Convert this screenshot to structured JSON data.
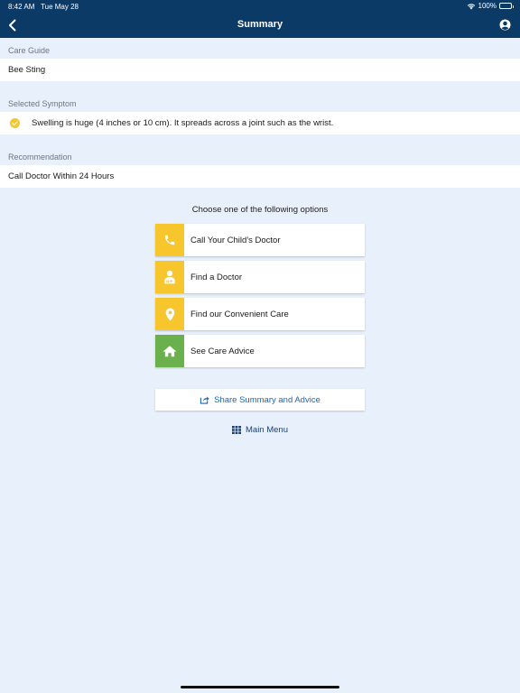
{
  "status": {
    "time": "8:42 AM",
    "date": "Tue May 28",
    "battery": "100%",
    "battery_level": 1.0
  },
  "header": {
    "title": "Summary",
    "back_icon": "chevron-left-icon",
    "account_icon": "user-circle-icon"
  },
  "care_guide": {
    "label": "Care Guide",
    "value": "Bee Sting"
  },
  "selected_symptom": {
    "label": "Selected Symptom",
    "value": "Swelling is huge (4 inches or 10 cm). It spreads across a joint such as the wrist.",
    "icon": "check-circle-icon"
  },
  "recommendation": {
    "label": "Recommendation",
    "value": "Call Doctor Within 24 Hours"
  },
  "options": {
    "title": "Choose one of the following options",
    "items": [
      {
        "label": "Call Your Child's Doctor",
        "icon": "phone-icon",
        "color": "#f7c52c"
      },
      {
        "label": "Find a Doctor",
        "icon": "doctor-icon",
        "color": "#f7c52c"
      },
      {
        "label": "Find our Convenient Care",
        "icon": "map-pin-icon",
        "color": "#f7c52c"
      },
      {
        "label": "See Care Advice",
        "icon": "home-icon",
        "color": "#6ab04c"
      }
    ]
  },
  "share": {
    "label": "Share Summary and Advice",
    "icon": "share-icon",
    "color": "#1d64b8"
  },
  "main_menu": {
    "label": "Main Menu",
    "icon": "grid-icon",
    "color": "#1d3f73"
  },
  "colors": {
    "header": "#0c3a66",
    "background": "#e8f0fb",
    "check": "#f7c52c"
  }
}
